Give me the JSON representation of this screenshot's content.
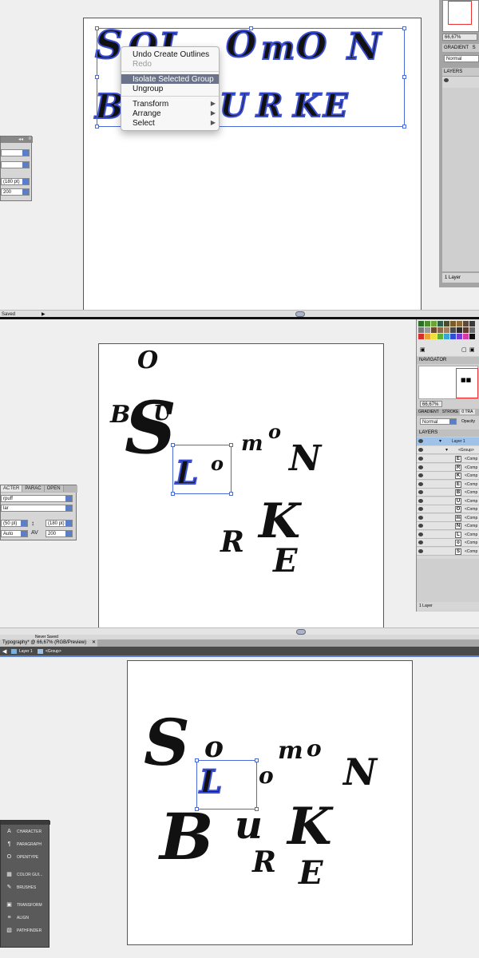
{
  "section1": {
    "letters_line1": [
      "S",
      "O",
      "L",
      "O",
      "m",
      "O",
      "N"
    ],
    "letters_line2": [
      "B",
      "U",
      "R",
      "K",
      "E"
    ],
    "context_menu": {
      "items": [
        {
          "label": "Undo Create Outlines",
          "state": "normal"
        },
        {
          "label": "Redo",
          "state": "disabled"
        },
        {
          "label": "Isolate Selected Group",
          "state": "active"
        },
        {
          "label": "Ungroup",
          "state": "normal"
        },
        {
          "label": "Transform",
          "state": "normal",
          "submenu": true
        },
        {
          "label": "Arrange",
          "state": "normal",
          "submenu": true
        },
        {
          "label": "Select",
          "state": "normal",
          "submenu": true
        }
      ]
    },
    "char_panel": {
      "size_value": "(180 pt)",
      "leading_value": "200"
    },
    "right_panel": {
      "zoom": "66,67%",
      "tab_gradient": "GRADIENT",
      "tab_stroke": "S",
      "blend_mode": "Normal",
      "layers_title": "LAYERS",
      "layer_count": "1 Layer"
    },
    "status": {
      "saved": "Saved"
    }
  },
  "section2": {
    "letters": [
      {
        "char": "O"
      },
      {
        "char": "B"
      },
      {
        "char": "U"
      },
      {
        "char": "S"
      },
      {
        "char": "L"
      },
      {
        "char": "o"
      },
      {
        "char": "m"
      },
      {
        "char": "o"
      },
      {
        "char": "N"
      },
      {
        "char": "K"
      },
      {
        "char": "R"
      },
      {
        "char": "E"
      }
    ],
    "char_panel": {
      "tab_character": "ACTER",
      "tab_paragraph": "PARAC",
      "tab_opentype": "OPEN",
      "font_value": "rpuff",
      "style_value": "lar",
      "size_value": "(50 pt)",
      "leading_value": "(180 pt)",
      "tracking_value": "Auto",
      "kerning_value": "200"
    },
    "right_panel": {
      "navigator_title": "NAVIGATOR",
      "zoom": "66,67%",
      "tab_gradient": "GRADIENT",
      "tab_stroke": "STROKE",
      "tab_transparency": "0 TRA",
      "blend_mode": "Normal",
      "opacity_label": "Opacity",
      "layers_title": "LAYERS",
      "layer_name": "Layer 1",
      "group_name": "<Group>",
      "compound_label": "<Comp",
      "compound_thumbs": [
        "E",
        "R",
        "K",
        "E",
        "B",
        "U",
        "O",
        "m",
        "N",
        "L",
        "o",
        "S"
      ],
      "layer_count": "1 Layer"
    }
  },
  "section3": {
    "status_saved": "Never Saved",
    "doc_tab": "Typography* @ 66,67% (RGB/Preview)",
    "breadcrumb_layer": "Layer 1",
    "breadcrumb_group": "<Group>",
    "letters": [
      {
        "char": "S"
      },
      {
        "char": "o"
      },
      {
        "char": "m"
      },
      {
        "char": "o"
      },
      {
        "char": "N"
      },
      {
        "char": "L"
      },
      {
        "char": "o"
      },
      {
        "char": "B"
      },
      {
        "char": "u"
      },
      {
        "char": "K"
      },
      {
        "char": "R"
      },
      {
        "char": "E"
      }
    ],
    "tools_panel": {
      "items": [
        {
          "label": "CHARACTER",
          "icon": "character-icon"
        },
        {
          "label": "PARAGRAPH",
          "icon": "paragraph-icon"
        },
        {
          "label": "OPENTYPE",
          "icon": "opentype-icon"
        },
        {
          "label": "COLOR GUI...",
          "icon": "color-guide-icon"
        },
        {
          "label": "BRUSHES",
          "icon": "brushes-icon"
        },
        {
          "label": "TRANSFORM",
          "icon": "transform-icon"
        },
        {
          "label": "ALIGN",
          "icon": "align-icon"
        },
        {
          "label": "PATHFINDER",
          "icon": "pathfinder-icon"
        }
      ]
    }
  },
  "colors": {
    "selection": "#4a6bd8",
    "menu_active": "#6a7389",
    "dropdown": "#5a7fc8",
    "layer_highlight": "#9fc3e8"
  }
}
